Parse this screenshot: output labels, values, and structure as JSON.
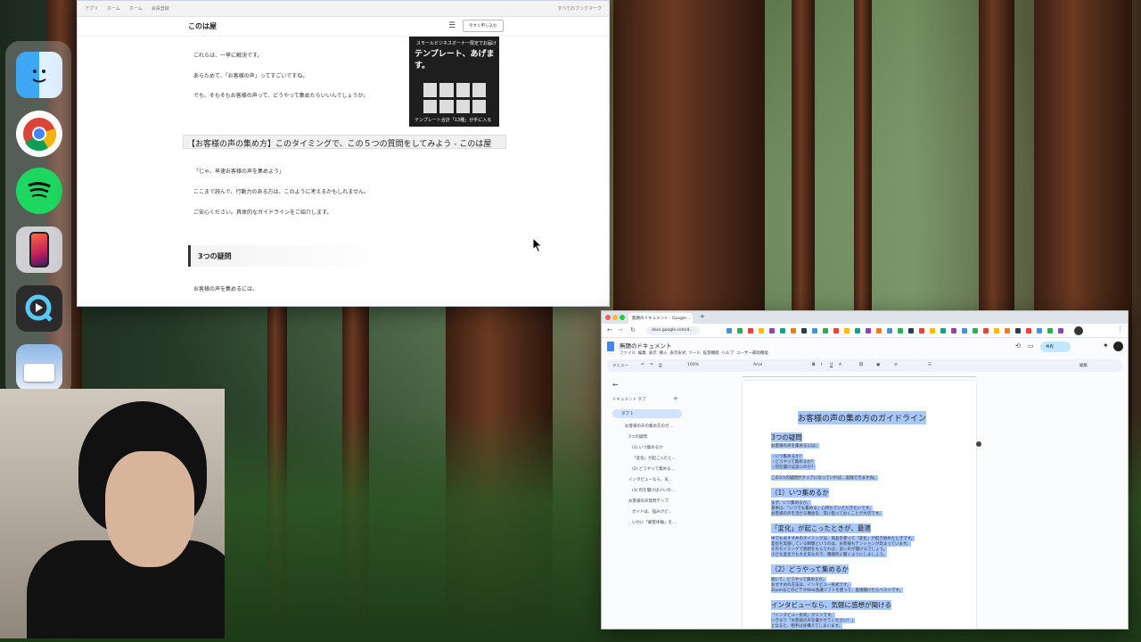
{
  "dock": {
    "items": [
      "finder-icon",
      "chrome-icon",
      "spotify-icon",
      "iphone-mirroring-icon",
      "quicktime-icon",
      "preview-icon"
    ]
  },
  "blog_window": {
    "bookmarks": [
      "アプリ",
      "ホーム",
      "ホーム",
      "会員登録",
      "すべてのブックマーク"
    ],
    "site_title": "このは屋",
    "header_button": "今すぐ申し込む",
    "paragraphs_top": [
      "これらは、一挙に解決です。",
      "あらためて、「お客様の声」ってすごいですね。",
      "でも、そもそもお客様の声って、どうやって集めたらいいんでしょうか。"
    ],
    "ad": {
      "line1": "スモールビジネスオーナー限定でお届け",
      "line2": "テンプレート、あげます。",
      "line3": "テンプレート合計「13種」が手に入る"
    },
    "tooltip": "【お客様の声の集め方】このタイミングで、この５つの質問をしてみよう - このは屋",
    "paragraphs_mid": [
      "「じゃ、早速お客様の声を集めよう」",
      "ここまで読んで、行動力のある方は、このように考えるかもしれません。",
      "ご安心ください。具体的なガイドラインをご紹介します。"
    ],
    "section_heading": "3つの疑問",
    "paragraph_bottom": "お客様の声を集めるには、"
  },
  "docs_window": {
    "tab_title": "無題のドキュメント - Google ...",
    "url": "docs.google.com/d...",
    "doc_title": "無題のドキュメント",
    "menus": [
      "ファイル",
      "編集",
      "表示",
      "挿入",
      "表示形式",
      "ツール",
      "拡張機能",
      "ヘルプ",
      "ユーザー補助機能"
    ],
    "toolbar": {
      "menus": "メニュー",
      "zoom": "100%",
      "font": "Arial",
      "edit_mode": "編集"
    },
    "share_label": "共有",
    "sidebar": {
      "label": "ドキュメント タブ",
      "tab": "タブ 1",
      "outline": [
        "お客様の声の集め方のガ...",
        "3つの疑問",
        "(1) いつ集めるか",
        "「変化」が起こったと...",
        "(2) どうやって集める...",
        "インタビューなら、気...",
        "(3) 何を聞けばいいの...",
        "お客様の声質問テンプ",
        "ガイドは、悩みがど...",
        "いかに「顧客体験」を..."
      ]
    },
    "content": {
      "title": "お客様の声の集め方のガイドライン",
      "h_questions": "3つの疑問",
      "p1": "お客様の声を集めるには、",
      "list": [
        "・いつ集めるか？",
        "・どうやって集めるか？",
        "・何を聞けば良いのか？"
      ],
      "p2": "この3つの疑問がクリアになっていれば、実践できますね。",
      "h_when": "（1）いつ集めるか",
      "when_lines": [
        "まず、いつ集めるか。",
        "基本は、「いつでも集める」心持ちでいただきたいです。",
        "お客様の声を活かる機会を、常に狙っておくことが大切です。"
      ],
      "h_change": "「変化」が起こったときが、最適",
      "change_lines": [
        "中でもおすすめのタイミングは、商品を使って「変化」が起き始めたときです。",
        "変化を実感している瞬間というのは、お客様もテンションが高まっています。",
        "そのタイミングで感想をもらえれば、良い声が聞けるでしょう。",
        "小さな変化でも大丈夫なので、積極的に聞くようにしましょう。"
      ],
      "h_how": "（2）どうやって集めるか",
      "how_lines": [
        "続いて、どうやって集めるか。",
        "おすすめの方法は、インタビュー形式です。",
        "ZoomなどのビデオWeb会議ソフトを使って、直接聞けたらベストです。"
      ],
      "h_interview": "インタビューなら、気軽に感想が聞ける",
      "interview_lines": [
        "「インタビュー形式」がミソです。",
        "いきなり「お客様の声を書かせてください！」",
        "となると、相手は身構えてしまいます。"
      ]
    }
  }
}
